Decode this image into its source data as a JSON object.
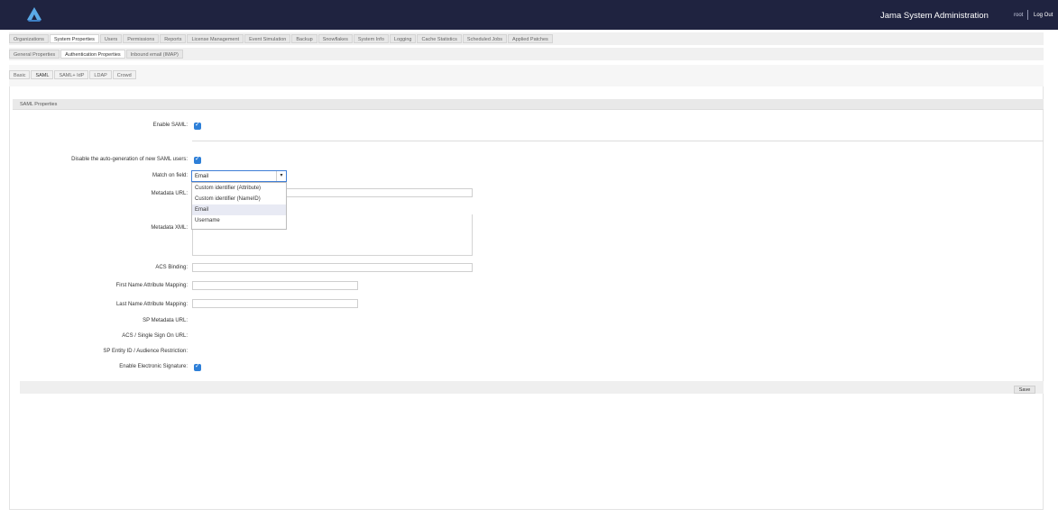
{
  "header": {
    "app_title": "Jama System Administration",
    "user": "root",
    "logout": "Log Out"
  },
  "main_tabs": [
    "Organizations",
    "System Properties",
    "Users",
    "Permissions",
    "Reports",
    "License Management",
    "Event Simulation",
    "Backup",
    "Snowflakes",
    "System Info",
    "Logging",
    "Cache Statistics",
    "Scheduled Jobs",
    "Applied Patches"
  ],
  "sub_tabs": [
    "General Properties",
    "Authentication Properties",
    "Inbound email (IMAP)"
  ],
  "auth_tabs": [
    "Basic",
    "SAML",
    "SAML+ IdP",
    "LDAP",
    "Crowd"
  ],
  "section_title": "SAML Properties",
  "fields": {
    "enable_saml": "Enable SAML:",
    "disable_autogen": "Disable the auto-generation of new SAML users:",
    "match_on_field": "Match on field:",
    "metadata_url": "Metadata URL:",
    "metadata_xml": "Metadata XML:",
    "acs_binding": "ACS Binding:",
    "first_name_mapping": "First Name Attribute Mapping:",
    "last_name_mapping": "Last Name Attribute Mapping:",
    "sp_metadata_url": "SP Metadata URL:",
    "acs_sso_url": "ACS / Single Sign On URL:",
    "sp_entity_id": "SP Entity ID / Audience Restriction:",
    "enable_esig": "Enable Electronic Signature:"
  },
  "match_select": {
    "value": "Email",
    "options": [
      "Custom identifier (Attribute)",
      "Custom identifier (NameID)",
      "Email",
      "Username"
    ]
  },
  "save_label": "Save",
  "colors": {
    "header_bg": "#1f2340",
    "checkbox": "#2d7fd8",
    "select_border": "#3f7ed6"
  }
}
